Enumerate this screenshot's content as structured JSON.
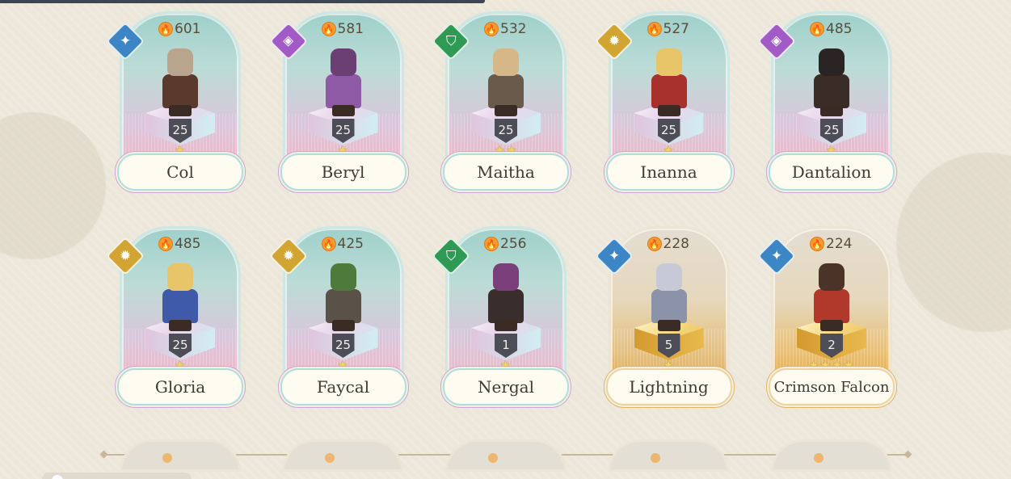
{
  "heroes": [
    {
      "name": "Col",
      "power": "601",
      "level": "25",
      "stars": "★",
      "element": "wind-icon",
      "rarity": "normal",
      "colors": {
        "head": "#b9a48e",
        "body": "#5b3a2e"
      }
    },
    {
      "name": "Beryl",
      "power": "581",
      "level": "25",
      "stars": "★",
      "element": "arcane-icon",
      "rarity": "normal",
      "colors": {
        "head": "#6b3e74",
        "body": "#8e5aa5"
      }
    },
    {
      "name": "Maitha",
      "power": "532",
      "level": "25",
      "stars": "★★",
      "element": "nature-icon",
      "rarity": "normal",
      "colors": {
        "head": "#d6b888",
        "body": "#6a5a4c"
      }
    },
    {
      "name": "Inanna",
      "power": "527",
      "level": "25",
      "stars": "★",
      "element": "light-icon",
      "rarity": "normal",
      "colors": {
        "head": "#e9c56a",
        "body": "#a8302d"
      }
    },
    {
      "name": "Dantalion",
      "power": "485",
      "level": "25",
      "stars": "★",
      "element": "arcane-icon",
      "rarity": "normal",
      "colors": {
        "head": "#2a2424",
        "body": "#3a2d28"
      }
    },
    {
      "name": "Gloria",
      "power": "485",
      "level": "25",
      "stars": "★",
      "element": "light-icon",
      "rarity": "normal",
      "colors": {
        "head": "#e9c56a",
        "body": "#3e5aa8"
      }
    },
    {
      "name": "Faycal",
      "power": "425",
      "level": "25",
      "stars": "★",
      "element": "light-icon",
      "rarity": "normal",
      "colors": {
        "head": "#4e7a3c",
        "body": "#5a5148"
      }
    },
    {
      "name": "Nergal",
      "power": "256",
      "level": "1",
      "stars": "★",
      "element": "nature-icon",
      "rarity": "normal",
      "colors": {
        "head": "#7a3e7a",
        "body": "#3a2e2c"
      }
    },
    {
      "name": "Lightning",
      "power": "228",
      "level": "5",
      "stars": "★",
      "element": "wind-icon",
      "rarity": "gold",
      "colors": {
        "head": "#c7cad6",
        "body": "#8c93a8"
      }
    },
    {
      "name": "Crimson Falcon",
      "power": "224",
      "level": "2",
      "stars": "★★★★",
      "element": "wind-icon",
      "rarity": "gold",
      "colors": {
        "head": "#4a3428",
        "body": "#b0392c"
      }
    }
  ],
  "element_glyphs": {
    "wind-icon": "✦",
    "arcane-icon": "◈",
    "nature-icon": "⛉",
    "light-icon": "✹"
  },
  "element_colors": {
    "wind-icon": "#3d86c6",
    "arcane-icon": "#a25ac6",
    "nature-icon": "#2f9a53",
    "light-icon": "#d2a532"
  }
}
